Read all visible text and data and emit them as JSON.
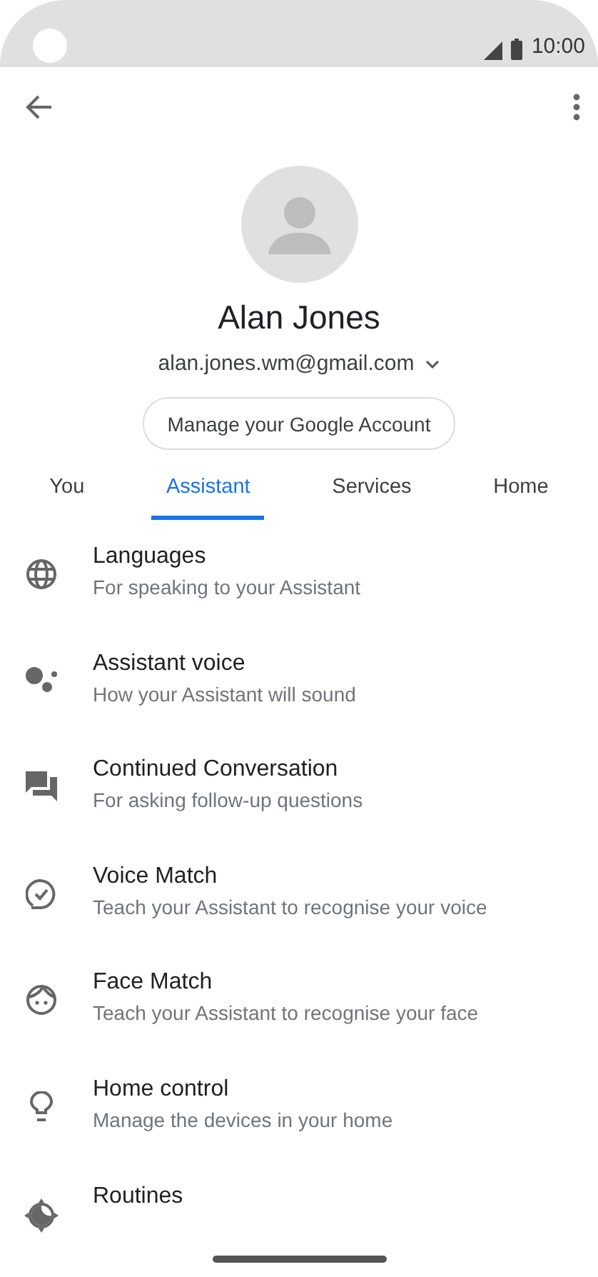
{
  "status_bar": {
    "time": "10:00"
  },
  "profile": {
    "name": "Alan Jones",
    "email": "alan.jones.wm@gmail.com",
    "manage_button": "Manage your Google Account"
  },
  "tabs": [
    {
      "label": "You",
      "selected": false
    },
    {
      "label": "Assistant",
      "selected": true
    },
    {
      "label": "Services",
      "selected": false
    },
    {
      "label": "Home",
      "selected": false
    }
  ],
  "settings": [
    {
      "title": "Languages",
      "subtitle": "For speaking to your Assistant"
    },
    {
      "title": "Assistant voice",
      "subtitle": "How your Assistant will sound"
    },
    {
      "title": "Continued Conversation",
      "subtitle": "For asking follow-up questions"
    },
    {
      "title": "Voice Match",
      "subtitle": "Teach your Assistant to recognise your voice"
    },
    {
      "title": "Face Match",
      "subtitle": "Teach your Assistant to recognise your face"
    },
    {
      "title": "Home control",
      "subtitle": "Manage the devices in your home"
    },
    {
      "title": "Routines"
    }
  ]
}
